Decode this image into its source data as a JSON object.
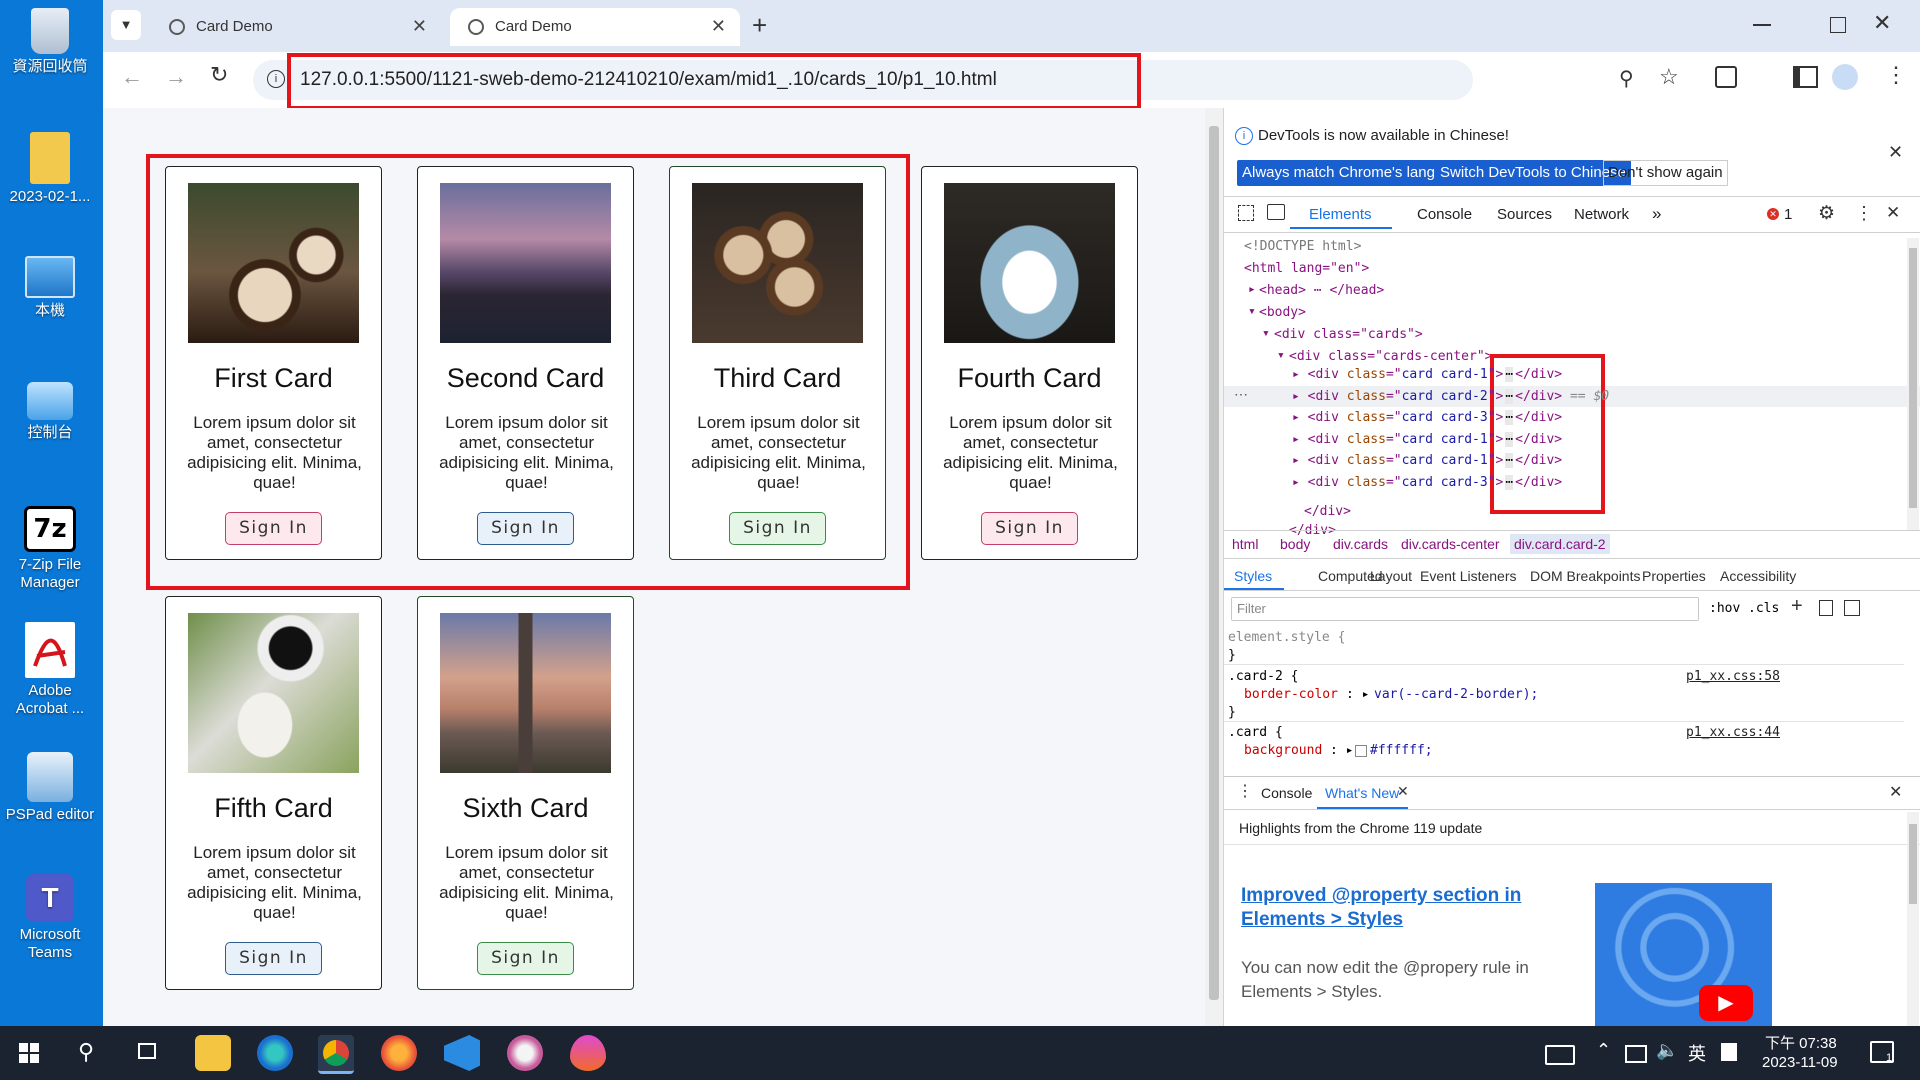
{
  "desktop": {
    "icons": [
      {
        "label": "資源回收筒",
        "icon": "recycle-bin-icon"
      },
      {
        "label": "2023-02-1...",
        "icon": "folder-icon"
      },
      {
        "label": "本機",
        "icon": "computer-icon"
      },
      {
        "label": "控制台",
        "icon": "control-panel-icon"
      },
      {
        "label": "7-Zip File Manager",
        "icon": "7zip-icon"
      },
      {
        "label": "Adobe Acrobat ...",
        "icon": "acrobat-icon"
      },
      {
        "label": "PSPad editor",
        "icon": "pspad-icon"
      },
      {
        "label": "Microsoft Teams",
        "icon": "teams-icon"
      }
    ]
  },
  "browser": {
    "tabs": [
      {
        "title": "Card Demo",
        "active": false
      },
      {
        "title": "Card Demo",
        "active": true
      }
    ],
    "url": "127.0.0.1:5500/1121-sweb-demo-212410210/exam/mid1_.10/cards_10/p1_10.html"
  },
  "page": {
    "cards": [
      {
        "title": "First Card",
        "text": "Lorem ipsum dolor sit amet, consectetur adipisicing elit. Minima, quae!",
        "button": "Sign In",
        "style": "pink"
      },
      {
        "title": "Second Card",
        "text": "Lorem ipsum dolor sit amet, consectetur adipisicing elit. Minima, quae!",
        "button": "Sign In",
        "style": "blue"
      },
      {
        "title": "Third Card",
        "text": "Lorem ipsum dolor sit amet, consectetur adipisicing elit. Minima, quae!",
        "button": "Sign In",
        "style": "green"
      },
      {
        "title": "Fourth Card",
        "text": "Lorem ipsum dolor sit amet, consectetur adipisicing elit. Minima, quae!",
        "button": "Sign In",
        "style": "pink"
      },
      {
        "title": "Fifth Card",
        "text": "Lorem ipsum dolor sit amet, consectetur adipisicing elit. Minima, quae!",
        "button": "Sign In",
        "style": "blue"
      },
      {
        "title": "Sixth Card",
        "text": "Lorem ipsum dolor sit amet, consectetur adipisicing elit. Minima, quae!",
        "button": "Sign In",
        "style": "green"
      }
    ]
  },
  "devtools": {
    "banner": "DevTools is now available in Chinese!",
    "banner_btn1": "Always match Chrome's language",
    "banner_btn2": "Switch DevTools to Chinese",
    "banner_btn3": "Don't show again",
    "tabs": [
      "Elements",
      "Console",
      "Sources",
      "Network"
    ],
    "error_count": "1",
    "dom": {
      "doctype": "<!DOCTYPE html>",
      "html_open": "<html lang=\"en\">",
      "head": "<head> ⋯ </head>",
      "body_open": "<body>",
      "cards_div": "<div class=\"cards\">",
      "cards_center": "<div class=\"cards-center\">",
      "card_rows": [
        "card card-1",
        "card card-2",
        "card card-3",
        "card card-1",
        "card card-1",
        "card card-3"
      ],
      "selected_suffix": "== $0",
      "div_close": "</div>",
      "div_close2": "</div>"
    },
    "breadcrumbs": [
      "html",
      "body",
      "div.cards",
      "div.cards-center",
      "div.card.card-2"
    ],
    "style_tabs": [
      "Styles",
      "Computed",
      "Layout",
      "Event Listeners",
      "DOM Breakpoints",
      "Properties",
      "Accessibility"
    ],
    "filter_placeholder": "Filter",
    "hov": ":hov",
    "cls": ".cls",
    "rules": {
      "element_style": "element.style {",
      "close1": "}",
      "card2_sel": ".card-2 {",
      "card2_prop": "border-color",
      "card2_val": "var(--card-2-border);",
      "card2_src": "p1_xx.css:58",
      "close2": "}",
      "card_sel": ".card {",
      "card_prop": "background",
      "card_val": "#ffffff;",
      "card_src": "p1_xx.css:44"
    },
    "drawer": {
      "tabs": [
        "Console",
        "What's New"
      ],
      "highlight": "Highlights from the Chrome 119 update",
      "headline": "Improved @property section in Elements > Styles",
      "body": "You can now edit the @propery rule in Elements > Styles."
    }
  },
  "taskbar": {
    "ime": "英",
    "time": "下午 07:38",
    "date": "2023-11-09",
    "notifications": "1"
  }
}
